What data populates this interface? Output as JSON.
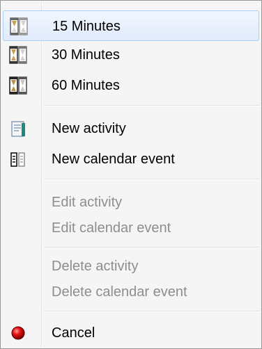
{
  "menu": {
    "items": [
      {
        "label": "15 Minutes",
        "icon": "hourglass-icon",
        "enabled": true,
        "highlighted": true
      },
      {
        "label": "30 Minutes",
        "icon": "hourglass-icon",
        "enabled": true
      },
      {
        "label": "60 Minutes",
        "icon": "hourglass-icon",
        "enabled": true
      },
      {
        "label": "New activity",
        "icon": "new-activity-icon",
        "enabled": true
      },
      {
        "label": "New calendar event",
        "icon": "new-calendar-event-icon",
        "enabled": true
      },
      {
        "label": "Edit activity",
        "enabled": false
      },
      {
        "label": "Edit calendar event",
        "enabled": false
      },
      {
        "label": "Delete activity",
        "enabled": false
      },
      {
        "label": "Delete calendar event",
        "enabled": false
      },
      {
        "label": "Cancel",
        "icon": "red-circle-icon",
        "enabled": true
      }
    ]
  },
  "colors": {
    "highlight_border": "#aecff7",
    "disabled_text": "#8d8d8d",
    "menu_background": "#f5f5f5"
  }
}
